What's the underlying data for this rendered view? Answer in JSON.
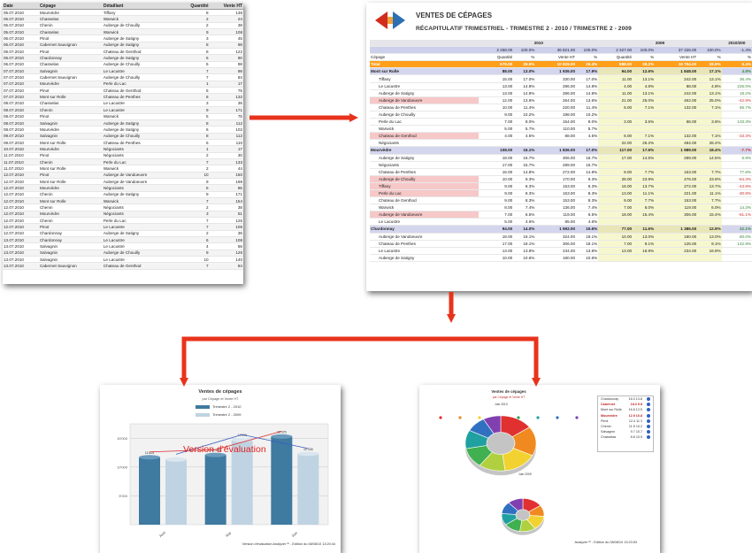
{
  "colors": {
    "arrow": "#e8331c",
    "accent_orange": "#ff9f1a",
    "bar_dark": "#3f7aa0",
    "bar_light": "#bfd3e2",
    "line_red": "#d93030",
    "line_blue": "#3a5fbf"
  },
  "raw_list": {
    "headers": [
      "Date",
      "Cépage",
      "Détaillant",
      "Quantité",
      "Vente HT"
    ],
    "rows": [
      [
        "05.07.2010",
        "Mourvèdre",
        "Tiffany",
        "8",
        "136"
      ],
      [
        "05.07.2010",
        "Chasselas",
        "Warwick",
        "2",
        "24"
      ],
      [
        "05.07.2010",
        "Chenin",
        "Auberge de Chouilly",
        "2",
        "38"
      ],
      [
        "05.07.2010",
        "Chasselas",
        "Warwick",
        "9",
        "108"
      ],
      [
        "06.07.2010",
        "Pinot",
        "Auberge de Satigny",
        "3",
        "45"
      ],
      [
        "06.07.2010",
        "Cabernet Sauvignon",
        "Auberge de Satigny",
        "8",
        "98"
      ],
      [
        "06.07.2010",
        "Pinot",
        "Chateau de Genthod",
        "8",
        "122"
      ],
      [
        "06.07.2010",
        "Chardonnay",
        "Auberge de Satigny",
        "5",
        "90"
      ],
      [
        "06.07.2010",
        "Chasselas",
        "Auberge de Chouilly",
        "6",
        "98"
      ],
      [
        "07.07.2010",
        "Salvagnin",
        "Le Lacustre",
        "7",
        "98"
      ],
      [
        "07.07.2010",
        "Cabernet Sauvignon",
        "Auberge de Chouilly",
        "7",
        "84"
      ],
      [
        "07.07.2010",
        "Mourvèdre",
        "Perle du Lac",
        "1",
        "17"
      ],
      [
        "07.07.2010",
        "Pinot",
        "Chateau de Genthod",
        "5",
        "75"
      ],
      [
        "07.07.2010",
        "Mont sur Rolle",
        "Chateau de Penthes",
        "6",
        "132"
      ],
      [
        "08.07.2010",
        "Chasselas",
        "Le Lacustre",
        "3",
        "36"
      ],
      [
        "08.07.2010",
        "Chenin",
        "Le Lacustre",
        "9",
        "171"
      ],
      [
        "08.07.2010",
        "Pinot",
        "Warwick",
        "5",
        "75"
      ],
      [
        "08.07.2010",
        "Salvagnin",
        "Auberge de Satigny",
        "8",
        "112"
      ],
      [
        "08.07.2010",
        "Mourvèdre",
        "Auberge de Satigny",
        "6",
        "102"
      ],
      [
        "09.07.2010",
        "Salvagnin",
        "Auberge de Chouilly",
        "8",
        "112"
      ],
      [
        "09.07.2010",
        "Mont sur Rolle",
        "Chateau de Penthes",
        "5",
        "110"
      ],
      [
        "10.07.2010",
        "Mourvèdre",
        "Négociants",
        "1",
        "17"
      ],
      [
        "11.07.2010",
        "Pinot",
        "Négociants",
        "2",
        "30"
      ],
      [
        "11.07.2010",
        "Chenin",
        "Perle du Lac",
        "7",
        "133"
      ],
      [
        "11.07.2010",
        "Mont sur Rolle",
        "Warwick",
        "2",
        "44"
      ],
      [
        "12.07.2010",
        "Pinot",
        "Auberge de Vandoeuvre",
        "10",
        "150"
      ],
      [
        "12.07.2010",
        "Mont sur Rolle",
        "Auberge de Vandoeuvre",
        "9",
        "198"
      ],
      [
        "12.07.2010",
        "Mourvèdre",
        "Négociants",
        "5",
        "85"
      ],
      [
        "12.07.2010",
        "Chenin",
        "Auberge de Satigny",
        "9",
        "171"
      ],
      [
        "12.07.2010",
        "Mont sur Rolle",
        "Warwick",
        "7",
        "154"
      ],
      [
        "12.07.2010",
        "Chenin",
        "Négociants",
        "2",
        "38"
      ],
      [
        "12.07.2010",
        "Mourvèdre",
        "Négociants",
        "3",
        "51"
      ],
      [
        "12.07.2010",
        "Chenin",
        "Perle du Lac",
        "7",
        "126"
      ],
      [
        "12.07.2010",
        "Pinot",
        "Le Lacustre",
        "7",
        "105"
      ],
      [
        "12.07.2010",
        "Chardonnay",
        "Auberge de Satigny",
        "2",
        "36"
      ],
      [
        "13.07.2010",
        "Chardonnay",
        "Le Lacustre",
        "6",
        "108"
      ],
      [
        "13.07.2010",
        "Salvagnin",
        "Le Lacustre",
        "4",
        "56"
      ],
      [
        "13.07.2010",
        "Salvagnin",
        "Auberge de Chouilly",
        "9",
        "126"
      ],
      [
        "13.07.2010",
        "Salvagnin",
        "Le Lacustre",
        "10",
        "140"
      ],
      [
        "13.07.2010",
        "Cabernet Sauvignon",
        "Chateau de Genthod",
        "7",
        "84"
      ]
    ]
  },
  "recap": {
    "title": "VENTES DE CÉPAGES",
    "subtitle": "RÉCAPITULATIF TRIMESTRIEL - TRIMESTRE 2 - 2010 / TRIMESTRE 2 - 2009",
    "year_a": "2010",
    "year_b": "2009",
    "year_c": "2010/200",
    "totals": [
      "2 268.00",
      "100.0%",
      "36 821.00",
      "100.0%",
      "2 327.00",
      "100.0%",
      "37 326.00",
      "100.0%",
      "-1.4%"
    ],
    "col_cepage": "Cépage",
    "col_heads": [
      "Quantité",
      "%",
      "Vente HT",
      "%",
      "Quantité",
      "%",
      "Vente HT",
      "%",
      "%"
    ],
    "all_label": "Total",
    "all_row": [
      "679.00",
      "29.9%",
      "10 829.00",
      "29.4%",
      "888.00",
      "38.2%",
      "16 794.00",
      "28.9%",
      "6.4%"
    ],
    "rows": [
      {
        "type": "grp",
        "label": "Mont sur Rolle",
        "v": [
          "88.00",
          "13.0%",
          "1 936.00",
          "17.9%",
          "94.00",
          "12.6%",
          "1 848.00",
          "17.1%",
          "4.8%"
        ]
      },
      {
        "type": "row",
        "label": "Tiffany",
        "v": [
          "15.00",
          "17.0%",
          "330.00",
          "17.0%",
          "11.00",
          "13.1%",
          "242.00",
          "13.1%",
          "36.4%"
        ]
      },
      {
        "type": "row",
        "label": "Le Lacustre",
        "v": [
          "13.00",
          "14.8%",
          "286.00",
          "14.8%",
          "4.00",
          "4.8%",
          "88.00",
          "4.8%",
          "225.0%"
        ]
      },
      {
        "type": "row",
        "label": "Auberge de Satigny",
        "v": [
          "13.00",
          "14.8%",
          "286.00",
          "14.8%",
          "11.00",
          "13.1%",
          "242.00",
          "13.1%",
          "18.2%"
        ]
      },
      {
        "type": "hl",
        "label": "Auberge de Vandoeuvre",
        "v": [
          "12.00",
          "13.6%",
          "264.00",
          "13.6%",
          "21.00",
          "25.0%",
          "462.00",
          "25.0%",
          "-42.9%"
        ]
      },
      {
        "type": "row",
        "label": "Chateau de Penthes",
        "v": [
          "10.00",
          "11.4%",
          "220.00",
          "11.4%",
          "6.00",
          "7.1%",
          "132.00",
          "7.1%",
          "66.7%"
        ]
      },
      {
        "type": "row",
        "label": "Auberge de Chouilly",
        "v": [
          "9.00",
          "10.2%",
          "198.00",
          "10.2%",
          "",
          "",
          "",
          "",
          ""
        ]
      },
      {
        "type": "row",
        "label": "Perle du Lac",
        "v": [
          "7.00",
          "8.0%",
          "154.00",
          "8.0%",
          "3.00",
          "3.6%",
          "66.00",
          "3.6%",
          "133.3%"
        ]
      },
      {
        "type": "row",
        "label": "Warwick",
        "v": [
          "5.00",
          "5.7%",
          "110.00",
          "5.7%",
          "",
          "",
          "",
          "",
          ""
        ]
      },
      {
        "type": "hl",
        "label": "Chateau de Genthod",
        "v": [
          "4.00",
          "4.5%",
          "88.00",
          "4.5%",
          "6.00",
          "7.1%",
          "132.00",
          "7.1%",
          "-33.3%"
        ]
      },
      {
        "type": "row",
        "label": "Négociants",
        "v": [
          "",
          "",
          "",
          "",
          "22.00",
          "26.2%",
          "484.00",
          "26.2%",
          ""
        ]
      },
      {
        "type": "grp",
        "label": "Mourvèdre",
        "v": [
          "108.00",
          "16.1%",
          "1 836.00",
          "17.0%",
          "117.00",
          "17.6%",
          "1 989.00",
          "18.4%",
          "-7.7%"
        ]
      },
      {
        "type": "row",
        "label": "Auberge de Satigny",
        "v": [
          "18.00",
          "16.7%",
          "306.00",
          "16.7%",
          "17.00",
          "14.5%",
          "289.00",
          "14.5%",
          "5.9%"
        ]
      },
      {
        "type": "row",
        "label": "Négociants",
        "v": [
          "17.00",
          "15.7%",
          "289.00",
          "15.7%",
          "",
          "",
          "",
          "",
          ""
        ]
      },
      {
        "type": "row",
        "label": "Chateau de Penthes",
        "v": [
          "16.00",
          "14.8%",
          "272.00",
          "14.8%",
          "9.00",
          "7.7%",
          "153.00",
          "7.7%",
          "77.8%"
        ]
      },
      {
        "type": "hl",
        "label": "Auberge de Chouilly",
        "v": [
          "10.00",
          "9.3%",
          "170.00",
          "9.3%",
          "28.00",
          "23.9%",
          "476.00",
          "23.9%",
          "-64.3%"
        ]
      },
      {
        "type": "hl",
        "label": "Tiffany",
        "v": [
          "9.00",
          "8.3%",
          "153.00",
          "8.3%",
          "16.00",
          "13.7%",
          "272.00",
          "13.7%",
          "-43.8%"
        ]
      },
      {
        "type": "hl",
        "label": "Perle du Lac",
        "v": [
          "9.00",
          "8.3%",
          "153.00",
          "8.3%",
          "13.00",
          "11.1%",
          "221.00",
          "11.1%",
          "-30.8%"
        ]
      },
      {
        "type": "row",
        "label": "Chateau de Genthod",
        "v": [
          "9.00",
          "8.3%",
          "153.00",
          "8.3%",
          "9.00",
          "7.7%",
          "153.00",
          "7.7%",
          ""
        ]
      },
      {
        "type": "row",
        "label": "Warwick",
        "v": [
          "8.00",
          "7.4%",
          "136.00",
          "7.4%",
          "7.00",
          "6.0%",
          "119.00",
          "6.0%",
          "14.3%"
        ]
      },
      {
        "type": "hl",
        "label": "Auberge de Vandoeuvre",
        "v": [
          "7.00",
          "6.5%",
          "119.00",
          "6.5%",
          "18.00",
          "15.4%",
          "306.00",
          "15.4%",
          "-61.1%"
        ]
      },
      {
        "type": "row",
        "label": "Le Lacustre",
        "v": [
          "5.00",
          "4.6%",
          "85.00",
          "4.6%",
          "",
          "",
          "",
          "",
          ""
        ]
      },
      {
        "type": "grp",
        "label": "Chardonnay",
        "v": [
          "94.00",
          "14.0%",
          "1 692.00",
          "15.6%",
          "77.00",
          "11.6%",
          "1 386.00",
          "12.9%",
          "22.1%"
        ]
      },
      {
        "type": "row",
        "label": "Auberge de Vandoeuvre",
        "v": [
          "18.00",
          "19.1%",
          "324.00",
          "19.1%",
          "10.00",
          "13.0%",
          "180.00",
          "13.0%",
          "80.0%"
        ]
      },
      {
        "type": "row",
        "label": "Chateau de Penthes",
        "v": [
          "17.00",
          "18.1%",
          "306.00",
          "18.1%",
          "7.00",
          "9.1%",
          "126.00",
          "9.1%",
          "142.9%"
        ]
      },
      {
        "type": "row",
        "label": "Le Lacustre",
        "v": [
          "13.00",
          "13.8%",
          "234.00",
          "13.8%",
          "13.00",
          "16.9%",
          "234.00",
          "16.9%",
          ""
        ]
      },
      {
        "type": "row",
        "label": "Auberge de Satigny",
        "v": [
          "10.00",
          "10.6%",
          "180.00",
          "10.6%",
          "",
          "",
          "",
          "",
          ""
        ]
      }
    ]
  },
  "bar_chart": {
    "title": "Ventes de cépages",
    "subtitle": "par Cépage et Vente HT",
    "legend": [
      "Trimestre 2 - 2010",
      "Trimestre 2 - 2009"
    ],
    "watermark": "Version d'évaluation",
    "footer": "Version d'évaluation Analyzer™ - Edition du 08/08/10 13:20:44",
    "y_ticks": [
      "15'000",
      "10'000",
      "5'000"
    ],
    "x_labels": [
      "Avril",
      "Mai",
      "Juin"
    ]
  },
  "chart_data": {
    "type": "bar",
    "title": "Ventes de cépages",
    "subtitle": "par Cépage et Vente HT",
    "categories": [
      "Avril",
      "Mai",
      "Juin"
    ],
    "series": [
      {
        "name": "Trimestre 2 - 2010",
        "values": [
          11700,
          12100,
          15300
        ]
      },
      {
        "name": "Trimestre 2 - 2009",
        "values": [
          11300,
          14700,
          12300
        ]
      }
    ],
    "data_labels": [
      [
        "11'625",
        "12'139",
        "15'325"
      ],
      [
        "",
        "14'699",
        "12'338"
      ]
    ],
    "ylim": [
      0,
      17500
    ]
  },
  "pie_chart": {
    "title": "Ventes de cépages",
    "subtitle": "par Cépage et Vente HT",
    "top_label": "Juin 2010",
    "bottom_label": "Juin 2009",
    "footer": "Analyzer™ - Edition du 08/08/10 13:20:53",
    "legend": [
      {
        "name": "Chardonnay",
        "v1": "16.0",
        "v2": "13.8"
      },
      {
        "name": "Cabernet",
        "v1": "18.3",
        "v2": "9.8"
      },
      {
        "name": "Mont sur Rolle",
        "v1": "16.6",
        "v2": "12.5"
      },
      {
        "name": "Mourvèdre",
        "v1": "12.9",
        "v2": "10.8"
      },
      {
        "name": "Pinot",
        "v1": "12.4",
        "v2": "11.3"
      },
      {
        "name": "Chenin",
        "v1": "11.5",
        "v2": "10.2"
      },
      {
        "name": "Salvagnin",
        "v1": "9.7",
        "v2": "10.7"
      },
      {
        "name": "Chasselas",
        "v1": "8.6",
        "v2": "10.5"
      }
    ]
  }
}
